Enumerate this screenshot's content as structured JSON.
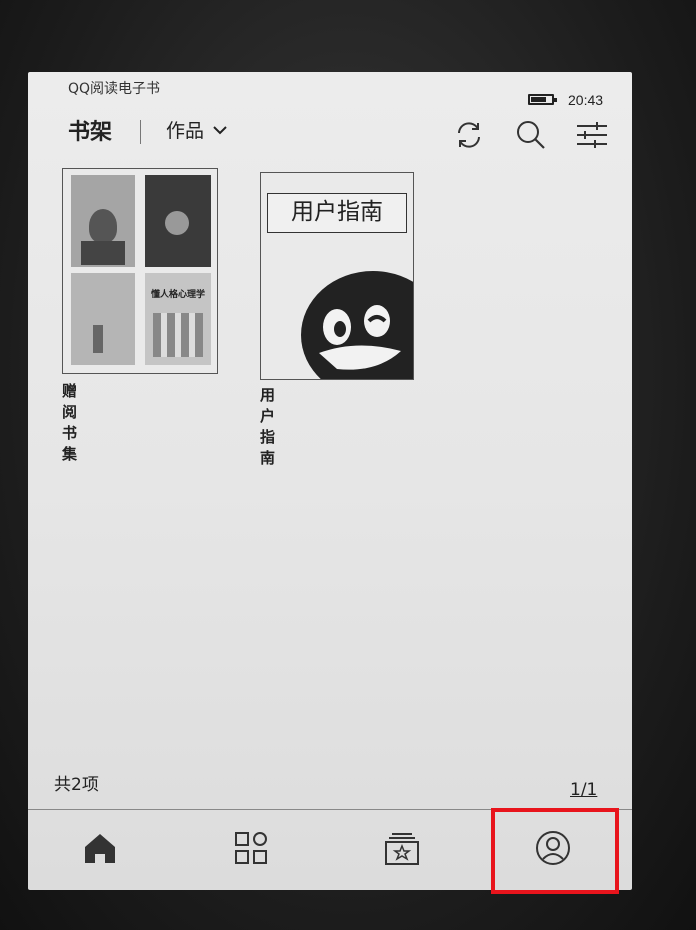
{
  "statusbar": {
    "app_name": "QQ阅读电子书",
    "time": "20:43"
  },
  "header": {
    "title": "书架",
    "filter_label": "作品",
    "icons": [
      "sync-icon",
      "search-icon",
      "filter-settings-icon"
    ]
  },
  "books": [
    {
      "title": "赠阅书集",
      "cover_type": "collage"
    },
    {
      "title": "用户指南",
      "cover_text": "用户指南",
      "cover_type": "qq-penguin"
    }
  ],
  "collage_cover_texts": [
    "懂人格心理学"
  ],
  "footer": {
    "count": "共2项",
    "page": "1/1"
  },
  "tabbar": {
    "tabs": [
      {
        "icon": "home-icon",
        "selected": true
      },
      {
        "icon": "categories-icon",
        "selected": false
      },
      {
        "icon": "store-icon",
        "selected": false
      },
      {
        "icon": "profile-icon",
        "selected": false
      }
    ]
  },
  "highlight_color": "#e8141c"
}
